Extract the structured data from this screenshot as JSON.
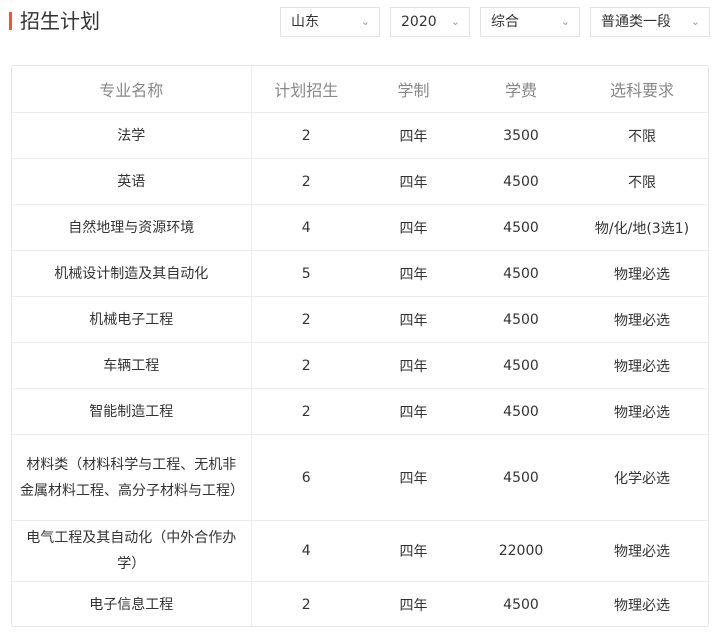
{
  "header": {
    "title": "招生计划",
    "filters": {
      "province": "山东",
      "year": "2020",
      "subject": "综合",
      "batch": "普通类一段"
    }
  },
  "table": {
    "columns": [
      "专业名称",
      "计划招生",
      "学制",
      "学费",
      "选科要求"
    ],
    "rows": [
      {
        "name": "法学",
        "plan": "2",
        "duration": "四年",
        "fee": "3500",
        "req": "不限"
      },
      {
        "name": "英语",
        "plan": "2",
        "duration": "四年",
        "fee": "4500",
        "req": "不限"
      },
      {
        "name": "自然地理与资源环境",
        "plan": "4",
        "duration": "四年",
        "fee": "4500",
        "req": "物/化/地(3选1)"
      },
      {
        "name": "机械设计制造及其自动化",
        "plan": "5",
        "duration": "四年",
        "fee": "4500",
        "req": "物理必选"
      },
      {
        "name": "机械电子工程",
        "plan": "2",
        "duration": "四年",
        "fee": "4500",
        "req": "物理必选"
      },
      {
        "name": "车辆工程",
        "plan": "2",
        "duration": "四年",
        "fee": "4500",
        "req": "物理必选"
      },
      {
        "name": "智能制造工程",
        "plan": "2",
        "duration": "四年",
        "fee": "4500",
        "req": "物理必选"
      },
      {
        "name": "材料类（材料科学与工程、无机非金属材料工程、高分子材料与工程）",
        "plan": "6",
        "duration": "四年",
        "fee": "4500",
        "req": "化学必选"
      },
      {
        "name": "电气工程及其自动化（中外合作办学）",
        "plan": "4",
        "duration": "四年",
        "fee": "22000",
        "req": "物理必选"
      },
      {
        "name": "电子信息工程",
        "plan": "2",
        "duration": "四年",
        "fee": "4500",
        "req": "物理必选"
      }
    ]
  }
}
